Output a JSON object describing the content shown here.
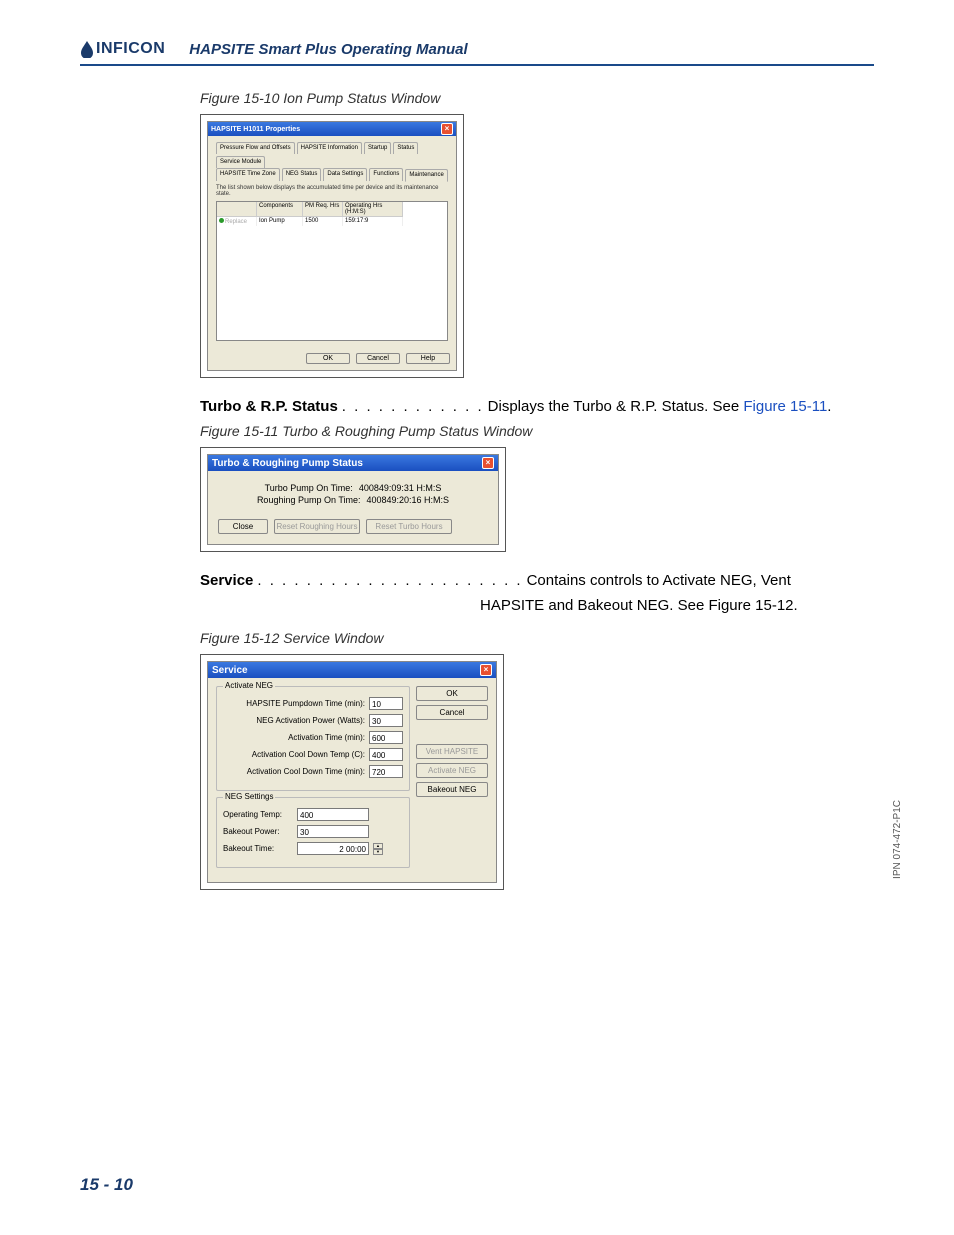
{
  "header": {
    "logo_text": "INFICON",
    "manual_title": "HAPSITE Smart Plus Operating Manual"
  },
  "fig10": {
    "caption": "Figure 15-10  Ion Pump Status Window",
    "dialog_title": "HAPSITE H1011 Properties",
    "tabs_top": [
      "Pressure Flow and Offsets",
      "HAPSITE Information",
      "Startup",
      "Status",
      "Service Module"
    ],
    "tabs_second": [
      "HAPSITE Time Zone",
      "NEG Status",
      "Data Settings",
      "Functions",
      "Maintenance"
    ],
    "info_text": "The list shown below displays the accumulated time per device and its maintenance state.",
    "col_components": "Components",
    "col_pm": "PM Req. Hrs",
    "col_op": "Operating Hrs (H:M:S)",
    "row_status": "Replace",
    "row_component": "Ion Pump",
    "row_pm": "1500",
    "row_op": "159:17:9",
    "btn_ok": "OK",
    "btn_cancel": "Cancel",
    "btn_help": "Help"
  },
  "entry_turbo": {
    "label": "Turbo & R.P. Status",
    "dots": ". . . . . . . . . . . .",
    "desc_pre": "Displays the Turbo & R.P. Status. See ",
    "link": "Figure 15-11",
    "desc_post": "."
  },
  "fig11": {
    "caption": "Figure 15-11  Turbo & Roughing Pump Status Window",
    "dialog_title": "Turbo & Roughing Pump Status",
    "turbo_label": "Turbo Pump On Time:",
    "turbo_value": "400849:09:31 H:M:S",
    "rough_label": "Roughing Pump On Time:",
    "rough_value": "400849:20:16 H:M:S",
    "btn_close": "Close",
    "btn_reset_rough": "Reset Roughing Hours",
    "btn_reset_turbo": "Reset Turbo Hours"
  },
  "entry_service": {
    "label": "Service",
    "dots": ". . . . . . . . . . . . . . . . . . . . . .",
    "desc_line1_pre": "Contains controls to Activate NEG, Vent",
    "desc_line2_pre": "HAPSITE and Bakeout NEG. See ",
    "link": "Figure 15-12",
    "desc_post": "."
  },
  "fig12": {
    "caption": "Figure 15-12  Service Window",
    "dialog_title": "Service",
    "legend_activate": "Activate NEG",
    "f_pumpdown": "HAPSITE Pumpdown Time (min):",
    "v_pumpdown": "10",
    "f_power": "NEG Activation Power (Watts):",
    "v_power": "30",
    "f_acttime": "Activation Time (min):",
    "v_acttime": "600",
    "f_cooldowntemp": "Activation Cool Down Temp (C):",
    "v_cooldowntemp": "400",
    "f_cooldowntime": "Activation Cool Down Time (min):",
    "v_cooldowntime": "720",
    "legend_settings": "NEG Settings",
    "f_optemp": "Operating Temp:",
    "v_optemp": "400",
    "f_bpower": "Bakeout Power:",
    "v_bpower": "30",
    "f_btime": "Bakeout Time:",
    "v_btime": "2  00:00",
    "btn_ok": "OK",
    "btn_cancel": "Cancel",
    "btn_vent": "Vent HAPSITE",
    "btn_activate": "Activate NEG",
    "btn_bakeout": "Bakeout NEG"
  },
  "footer": {
    "page": "15 - 10",
    "ipn": "IPN 074-472-P1C"
  }
}
